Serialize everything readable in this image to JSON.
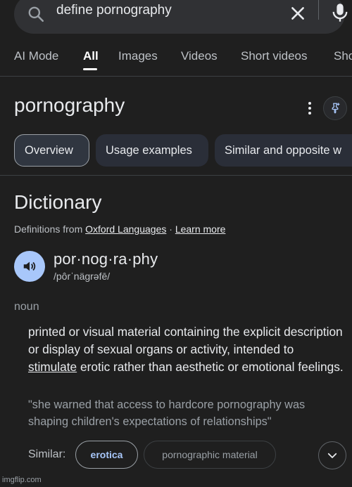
{
  "search": {
    "query": "define pornography"
  },
  "tabs": [
    {
      "label": "AI Mode"
    },
    {
      "label": "All"
    },
    {
      "label": "Images"
    },
    {
      "label": "Videos"
    },
    {
      "label": "Short videos"
    },
    {
      "label": "Sho"
    }
  ],
  "active_tab": "All",
  "term": {
    "title": "pornography"
  },
  "chips": [
    {
      "label": "Overview"
    },
    {
      "label": "Usage examples"
    },
    {
      "label": "Similar and opposite w"
    }
  ],
  "dictionary": {
    "heading": "Dictionary",
    "source_prefix": "Definitions from",
    "source_link": "Oxford Languages",
    "separator": "·",
    "learn_more": "Learn more",
    "syllables": "por·nog·ra·phy",
    "phonetic": "/pôrˈnäɡrəfē/",
    "part_of_speech": "noun",
    "definition_before": "printed or visual material containing the explicit description or display of sexual organs or activity, intended to",
    "definition_link": "stimulate",
    "definition_after": "erotic rather than aesthetic or emotional feelings.",
    "example": "\"she warned that access to hardcore pornography was shaping children's expectations of relationships\"",
    "similar_label": "Similar:",
    "similar": [
      "erotica",
      "pornographic material"
    ]
  },
  "watermark": "imgflip.com",
  "colors": {
    "background": "#1f1f1f",
    "accent": "#a8c7fa",
    "chip": "#2a2e38"
  },
  "icons": [
    "search-icon",
    "clear-icon",
    "mic-icon",
    "more-vert-icon",
    "pin-icon",
    "speaker-icon",
    "chevron-down-icon"
  ]
}
